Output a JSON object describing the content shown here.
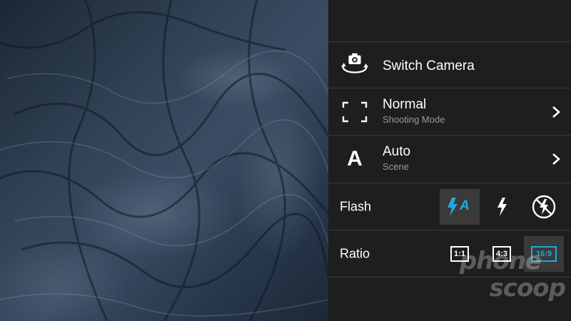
{
  "viewfinder": {
    "scene": "mountain-ridge-photo"
  },
  "menu": {
    "switch_camera": {
      "title": "Switch Camera",
      "icon": "switch-camera-icon"
    },
    "shooting_mode": {
      "title": "Normal",
      "subtitle": "Shooting Mode",
      "icon": "frame-corners-icon"
    },
    "scene": {
      "title": "Auto",
      "subtitle": "Scene",
      "icon_glyph": "A",
      "icon": "scene-auto-icon"
    },
    "flash": {
      "label": "Flash",
      "options": [
        {
          "name": "auto",
          "glyph": "A",
          "selected": true
        },
        {
          "name": "on",
          "selected": false
        },
        {
          "name": "off",
          "selected": false
        }
      ]
    },
    "ratio": {
      "label": "Ratio",
      "options": [
        {
          "label": "1:1",
          "selected": false
        },
        {
          "label": "4:3",
          "selected": false
        },
        {
          "label": "16:9",
          "selected": true
        }
      ]
    }
  },
  "colors": {
    "accent": "#1fa8e0",
    "panel_bg": "#1e1e1e",
    "divider": "#3a3a3a",
    "subtext": "#9a9a9a"
  },
  "watermark": {
    "line1": "phone",
    "line2": "scoop"
  }
}
